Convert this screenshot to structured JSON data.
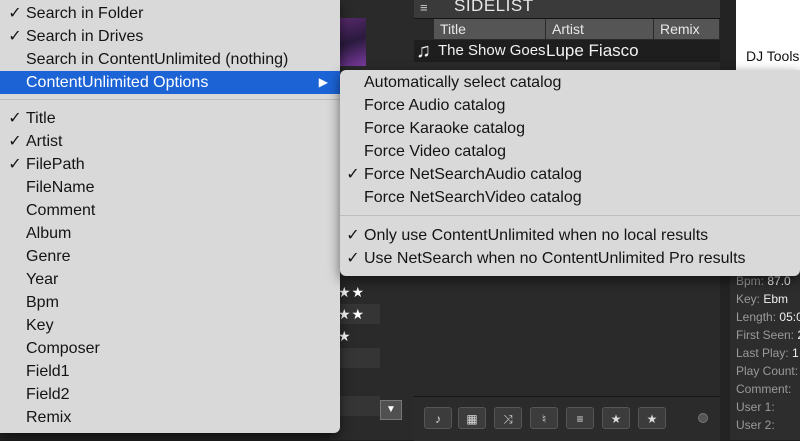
{
  "sidelist": {
    "title": "SIDELIST",
    "columns": [
      "Title",
      "Artist",
      "Remix"
    ],
    "track": {
      "title": "The Show Goes On",
      "artist": "Lupe Fiasco"
    }
  },
  "dj_tools_label": "DJ Tools",
  "info": [
    {
      "label": "Bpm:",
      "value": "87.0"
    },
    {
      "label": "Key:",
      "value": "Ebm"
    },
    {
      "label": "Length:",
      "value": "05:0"
    },
    {
      "label": "First Seen:",
      "value": "2"
    },
    {
      "label": "Last Play:",
      "value": "1"
    },
    {
      "label": "Play Count:",
      "value": ""
    },
    {
      "label": "Comment:",
      "value": ""
    },
    {
      "label": "User 1:",
      "value": ""
    },
    {
      "label": "User 2:",
      "value": ""
    }
  ],
  "main_menu": {
    "search_items": [
      {
        "label": "Search in Folder",
        "checked": true
      },
      {
        "label": "Search in Drives",
        "checked": true
      },
      {
        "label": "Search in ContentUnlimited (nothing)",
        "checked": false
      },
      {
        "label": "ContentUnlimited Options",
        "checked": false,
        "submenu": true
      }
    ],
    "field_items": [
      {
        "label": "Title",
        "checked": true
      },
      {
        "label": "Artist",
        "checked": true
      },
      {
        "label": "FilePath",
        "checked": true
      },
      {
        "label": "FileName",
        "checked": false
      },
      {
        "label": "Comment",
        "checked": false
      },
      {
        "label": "Album",
        "checked": false
      },
      {
        "label": "Genre",
        "checked": false
      },
      {
        "label": "Year",
        "checked": false
      },
      {
        "label": "Bpm",
        "checked": false
      },
      {
        "label": "Key",
        "checked": false
      },
      {
        "label": "Composer",
        "checked": false
      },
      {
        "label": "Field1",
        "checked": false
      },
      {
        "label": "Field2",
        "checked": false
      },
      {
        "label": "Remix",
        "checked": false
      }
    ]
  },
  "sub_menu": {
    "catalog_items": [
      {
        "label": "Automatically select catalog",
        "checked": false
      },
      {
        "label": "Force Audio catalog",
        "checked": false
      },
      {
        "label": "Force Karaoke catalog",
        "checked": false
      },
      {
        "label": "Force Video catalog",
        "checked": false
      },
      {
        "label": "Force NetSearchAudio catalog",
        "checked": true
      },
      {
        "label": "Force NetSearchVideo catalog",
        "checked": false
      }
    ],
    "option_items": [
      {
        "label": "Only use ContentUnlimited when no local results",
        "checked": true
      },
      {
        "label": "Use NetSearch when no ContentUnlimited Pro results",
        "checked": true
      }
    ]
  },
  "glyphs": {
    "check": "✓",
    "arrow": "▶",
    "note": "♫",
    "dropdown": "▼",
    "stars": "★★"
  },
  "colors": {
    "highlight": "#1c63d6",
    "menu_bg": "#d9d9d9"
  }
}
